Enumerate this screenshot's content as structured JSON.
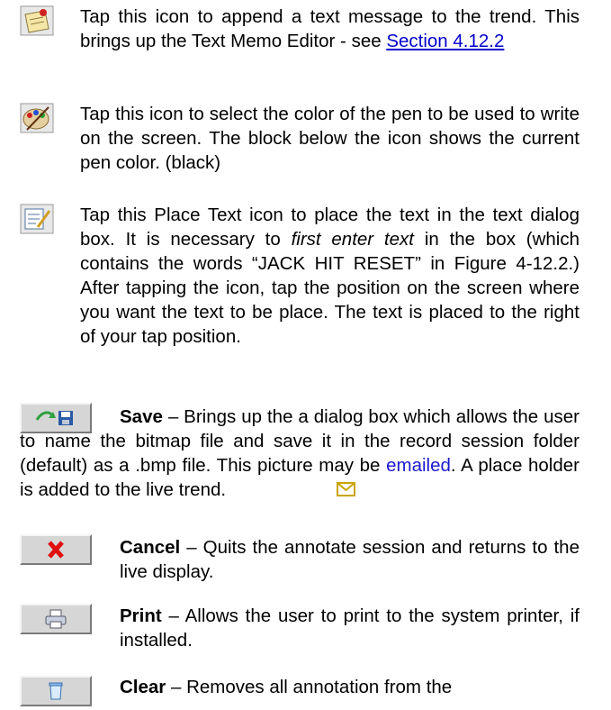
{
  "memo": {
    "text": "Tap this icon to append a text message to the trend. This brings up the Text Memo Editor - see ",
    "link": "Section 4.12.2",
    "icon": "memo-pin-icon"
  },
  "color": {
    "text": "Tap this icon to select the color of the pen to be used to write on the screen. The block below the icon shows the current pen color. (black)",
    "icon": "palette-icon"
  },
  "place_text": {
    "text1": "Tap this Place Text icon to place the text in the text dialog box. It is necessary to ",
    "italic": "first enter text",
    "text2": " in the box (which contains the words “JACK HIT RESET” in Figure 4-12.2.) After tapping the icon, tap the position on the screen where you want the text to be place. The text is placed to the right of your tap position.",
    "icon": "place-text-icon"
  },
  "save": {
    "label": "Save",
    "text1": " – Brings up the a dialog box which allows the user to name the bitmap file and save it in the record session folder (default) as a .bmp file. This picture may be ",
    "link": "emailed",
    "text2": ". A place holder is added to the live trend.",
    "icon": "save-icon",
    "marker_icon": "envelope-icon"
  },
  "cancel": {
    "label": "Cancel",
    "text": " – Quits the annotate session and returns to the live display.",
    "icon": "close-x-icon"
  },
  "print": {
    "label": "Print",
    "text": " – Allows the user to print to the system printer, if installed.",
    "icon": "printer-icon"
  },
  "clear": {
    "label": "Clear",
    "text": " – Removes all annotation from the",
    "icon": "trash-icon"
  }
}
